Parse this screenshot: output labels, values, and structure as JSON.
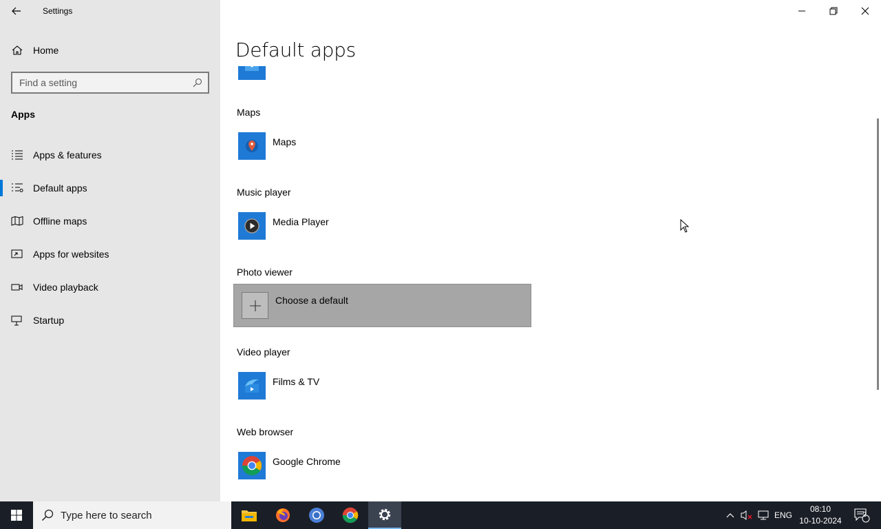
{
  "window": {
    "title": "Settings",
    "controls": {
      "minimize": "minimize",
      "maximize": "restore",
      "close": "close"
    }
  },
  "sidebar": {
    "home_label": "Home",
    "search_placeholder": "Find a setting",
    "section_title": "Apps",
    "items": [
      {
        "label": "Apps & features",
        "icon": "list-icon",
        "active": false
      },
      {
        "label": "Default apps",
        "icon": "default-apps-icon",
        "active": true
      },
      {
        "label": "Offline maps",
        "icon": "map-icon",
        "active": false
      },
      {
        "label": "Apps for websites",
        "icon": "link-window-icon",
        "active": false
      },
      {
        "label": "Video playback",
        "icon": "video-icon",
        "active": false
      },
      {
        "label": "Startup",
        "icon": "startup-icon",
        "active": false
      }
    ]
  },
  "main": {
    "page_title": "Default apps",
    "categories": [
      {
        "label": "Maps",
        "app": "Maps",
        "icon": "maps-icon"
      },
      {
        "label": "Music player",
        "app": "Media Player",
        "icon": "media-player-icon"
      },
      {
        "label": "Photo viewer",
        "app": "Choose a default",
        "icon": "plus-icon"
      },
      {
        "label": "Video player",
        "app": "Films & TV",
        "icon": "films-tv-icon"
      },
      {
        "label": "Web browser",
        "app": "Google Chrome",
        "icon": "chrome-icon"
      }
    ]
  },
  "taskbar": {
    "search_placeholder": "Type here to search",
    "apps": [
      "file-explorer-icon",
      "firefox-icon",
      "chromium-icon",
      "chrome-icon",
      "settings-icon"
    ],
    "language": "ENG",
    "time": "08:10",
    "date": "10-10-2024",
    "notification_count": "2"
  },
  "colors": {
    "accent": "#0078d7",
    "sidebar_bg": "#e6e6e6",
    "tile_blue": "#1f7ad6",
    "taskbar_bg": "#1a1e26",
    "selected_row": "#a6a6a6"
  }
}
